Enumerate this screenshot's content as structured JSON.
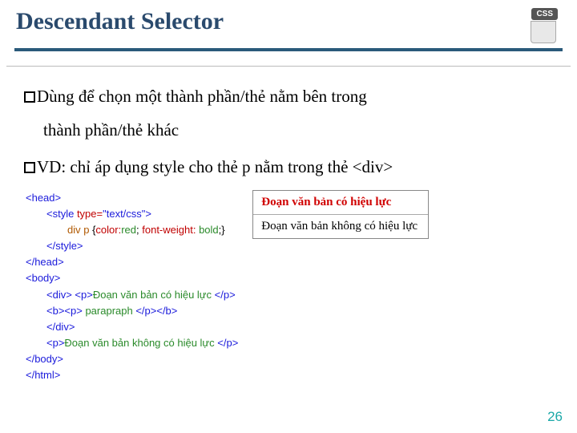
{
  "header": {
    "title": "Descendant Selector",
    "badge_text": "CSS"
  },
  "bullets": {
    "line1a": "Dùng để chọn một thành phần/thẻ nằm bên trong",
    "line1b": "thành phần/thẻ khác",
    "line2": "VD: chỉ áp dụng style cho thẻ p nằm trong thẻ <div>"
  },
  "code": {
    "head_open": "<head>",
    "style_open_tag": "<style ",
    "style_attr": "type=",
    "style_val": "\"text/css\"",
    "style_open_close": ">",
    "selector": "div p ",
    "brace_open": "{",
    "rule1k": "color:",
    "rule1v": "red",
    "semi": "; ",
    "rule2k": "font-weight: ",
    "rule2v": "bold",
    "brace_close": ";}",
    "style_close": "</style>",
    "head_close": "</head>",
    "body_open": "<body>",
    "div_open": "<div> <p>",
    "text1": "Đoạn văn bản có hiệu lực ",
    "p_close": "</p>",
    "b_open": "<b><p>",
    "text2": " parapraph ",
    "bp_close": "</p></b>",
    "div_close": "</div>",
    "p_open2": "<p>",
    "text3": "Đoạn văn bản không có hiệu lực ",
    "body_close": "</body>",
    "html_close": "</html>"
  },
  "output": {
    "line1": "Đoạn văn bản có hiệu lực",
    "line2": "Đoạn văn bản không có hiệu lực"
  },
  "page_number": "26"
}
